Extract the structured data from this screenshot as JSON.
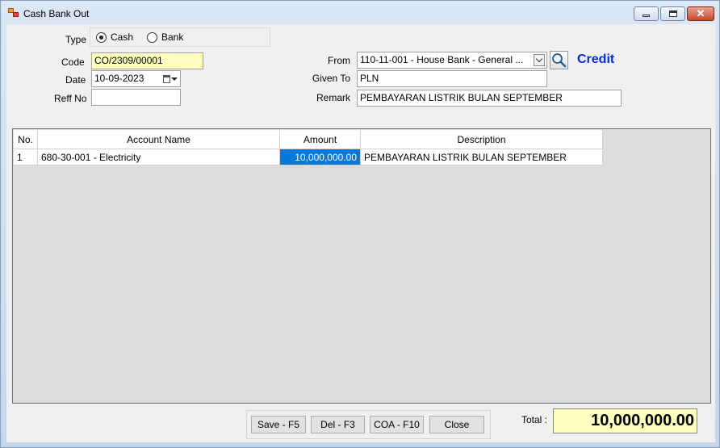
{
  "window": {
    "title": "Cash Bank Out"
  },
  "form": {
    "type_label": "Type",
    "type_options": [
      "Cash",
      "Bank"
    ],
    "type_selected": "Cash",
    "code_label": "Code",
    "code_value": "CO/2309/00001",
    "date_label": "Date",
    "date_value": "10-09-2023",
    "reff_label": "Reff No",
    "reff_value": "",
    "from_label": "From",
    "from_value": "110-11-001 - House Bank - General ...",
    "given_label": "Given To",
    "given_value": "PLN",
    "remark_label": "Remark",
    "remark_value": "PEMBAYARAN LISTRIK BULAN SEPTEMBER",
    "credit_label": "Credit",
    "credit_color": "#0a2ad6"
  },
  "grid": {
    "columns": [
      "No.",
      "Account Name",
      "Amount",
      "Description"
    ],
    "rows": [
      {
        "no": "1",
        "account": "680-30-001 - Electricity",
        "amount": "10,000,000.00",
        "description": "PEMBAYARAN LISTRIK BULAN SEPTEMBER"
      }
    ],
    "selection_color": "#0a78d7"
  },
  "buttons": {
    "save": "Save - F5",
    "del": "Del - F3",
    "coa": "COA - F10",
    "close": "Close"
  },
  "total": {
    "label": "Total :",
    "value": "10,000,000.00"
  },
  "icons": [
    "app-icon",
    "minimize-icon",
    "maximize-icon",
    "close-icon",
    "calendar-icon",
    "dropdown-arrow-icon",
    "search-icon"
  ]
}
